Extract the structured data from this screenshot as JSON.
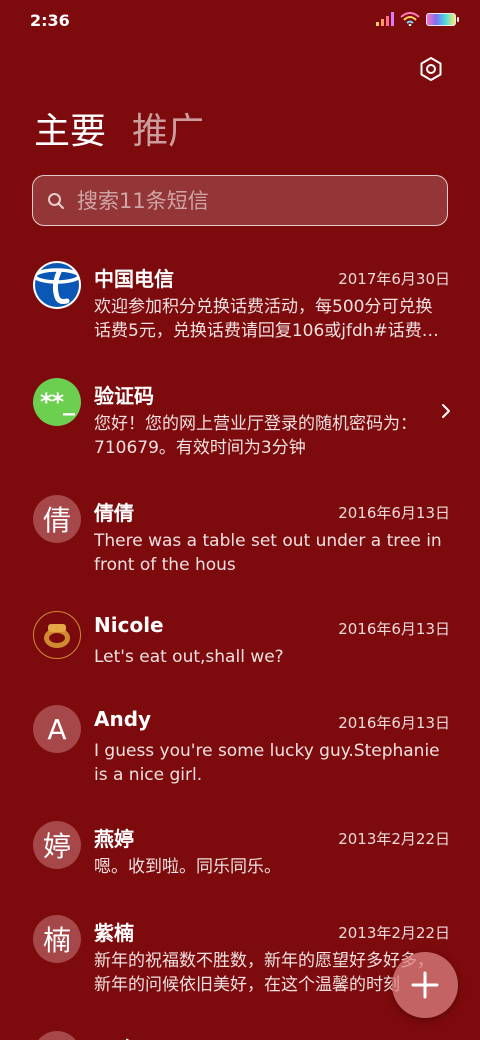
{
  "status": {
    "time": "2:36"
  },
  "tabs": {
    "primary": "主要",
    "promotions": "推广"
  },
  "search": {
    "placeholder": "搜索11条短信"
  },
  "conversations": [
    {
      "name": "中国电信",
      "date": "2017年6月30日",
      "preview": "欢迎参加积分兑换话费活动，每500分可兑换话费5元，兑换话费请回复106或jfdh#话费…",
      "avatar": "telecom-logo"
    },
    {
      "name": "验证码",
      "date": "",
      "preview": "您好！您的网上营业厅登录的随机密码为：710679。有效时间为3分钟",
      "avatar_text": "**_"
    },
    {
      "name": "倩倩",
      "date": "2016年6月13日",
      "preview": "There was a table set out under a tree in front of the hous",
      "avatar_text": "倩"
    },
    {
      "name": "Nicole",
      "date": "2016年6月13日",
      "preview": "Let's eat out,shall we?",
      "avatar": "photo"
    },
    {
      "name": "Andy",
      "date": "2016年6月13日",
      "preview": "I guess you're some lucky guy.Stephanie is a nice girl.",
      "avatar_text": "A"
    },
    {
      "name": "燕婷",
      "date": "2013年2月22日",
      "preview": "嗯。收到啦。同乐同乐。",
      "avatar_text": "婷"
    },
    {
      "name": "紫楠",
      "date": "2013年2月22日",
      "preview": "新年的祝福数不胜数，新年的愿望好多好多，新年的问候依旧美好，在这个温馨的时刻",
      "avatar_text": "楠"
    },
    {
      "name": "子玲",
      "date": "",
      "preview": "",
      "avatar_text": ""
    }
  ],
  "colors": {
    "background": "#7d0a0c",
    "avatar": "#a64749",
    "green_avatar": "#6ccf4f"
  },
  "icons": {
    "settings": "gear-icon",
    "search": "search-icon",
    "chevron": "chevron-right-icon",
    "fab": "plus-icon"
  }
}
